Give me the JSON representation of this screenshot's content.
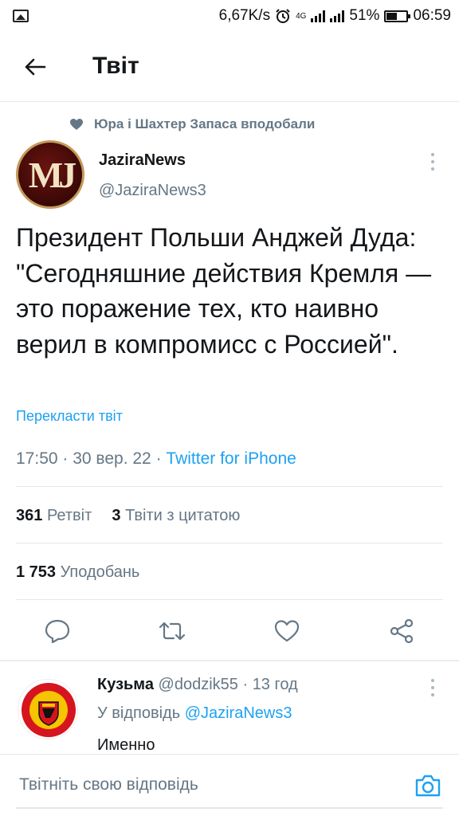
{
  "status_bar": {
    "speed": "6,67K/s",
    "network": "4G",
    "battery": "51%",
    "time": "06:59"
  },
  "header": {
    "title": "Твіт"
  },
  "social_context": {
    "text": "Юра і Шахтер Запаса вподобали"
  },
  "tweet": {
    "author_name": "JaziraNews",
    "author_handle": "@JaziraNews3",
    "avatar_initials": "MJ",
    "text": "Президент Польши Анджей Дуда: \"Сегодняшние действия Кремля — это поражение тех, кто наивно верил в компромисс с Россией\".",
    "translate_label": "Перекласти твіт",
    "time": "17:50",
    "date": "30 вер. 22",
    "source": "Twitter for iPhone",
    "retweets_count": "361",
    "retweets_label": "Ретвіт",
    "quotes_count": "3",
    "quotes_label": "Твіти з цитатою",
    "likes_count": "1 753",
    "likes_label": "Уподобань"
  },
  "actions": [
    "reply",
    "retweet",
    "like",
    "share"
  ],
  "reply": {
    "author_name": "Кузьма",
    "author_handle": "@dodzik55",
    "time_ago": "13 год",
    "reply_to_label": "У відповідь",
    "reply_to_handle": "@JaziraNews3",
    "text": "Именно"
  },
  "compose": {
    "placeholder": "Твітніть свою відповідь"
  },
  "colors": {
    "accent": "#1da1f2",
    "text_primary": "#14171a",
    "text_secondary": "#657786",
    "divider": "#e1e8ed"
  }
}
